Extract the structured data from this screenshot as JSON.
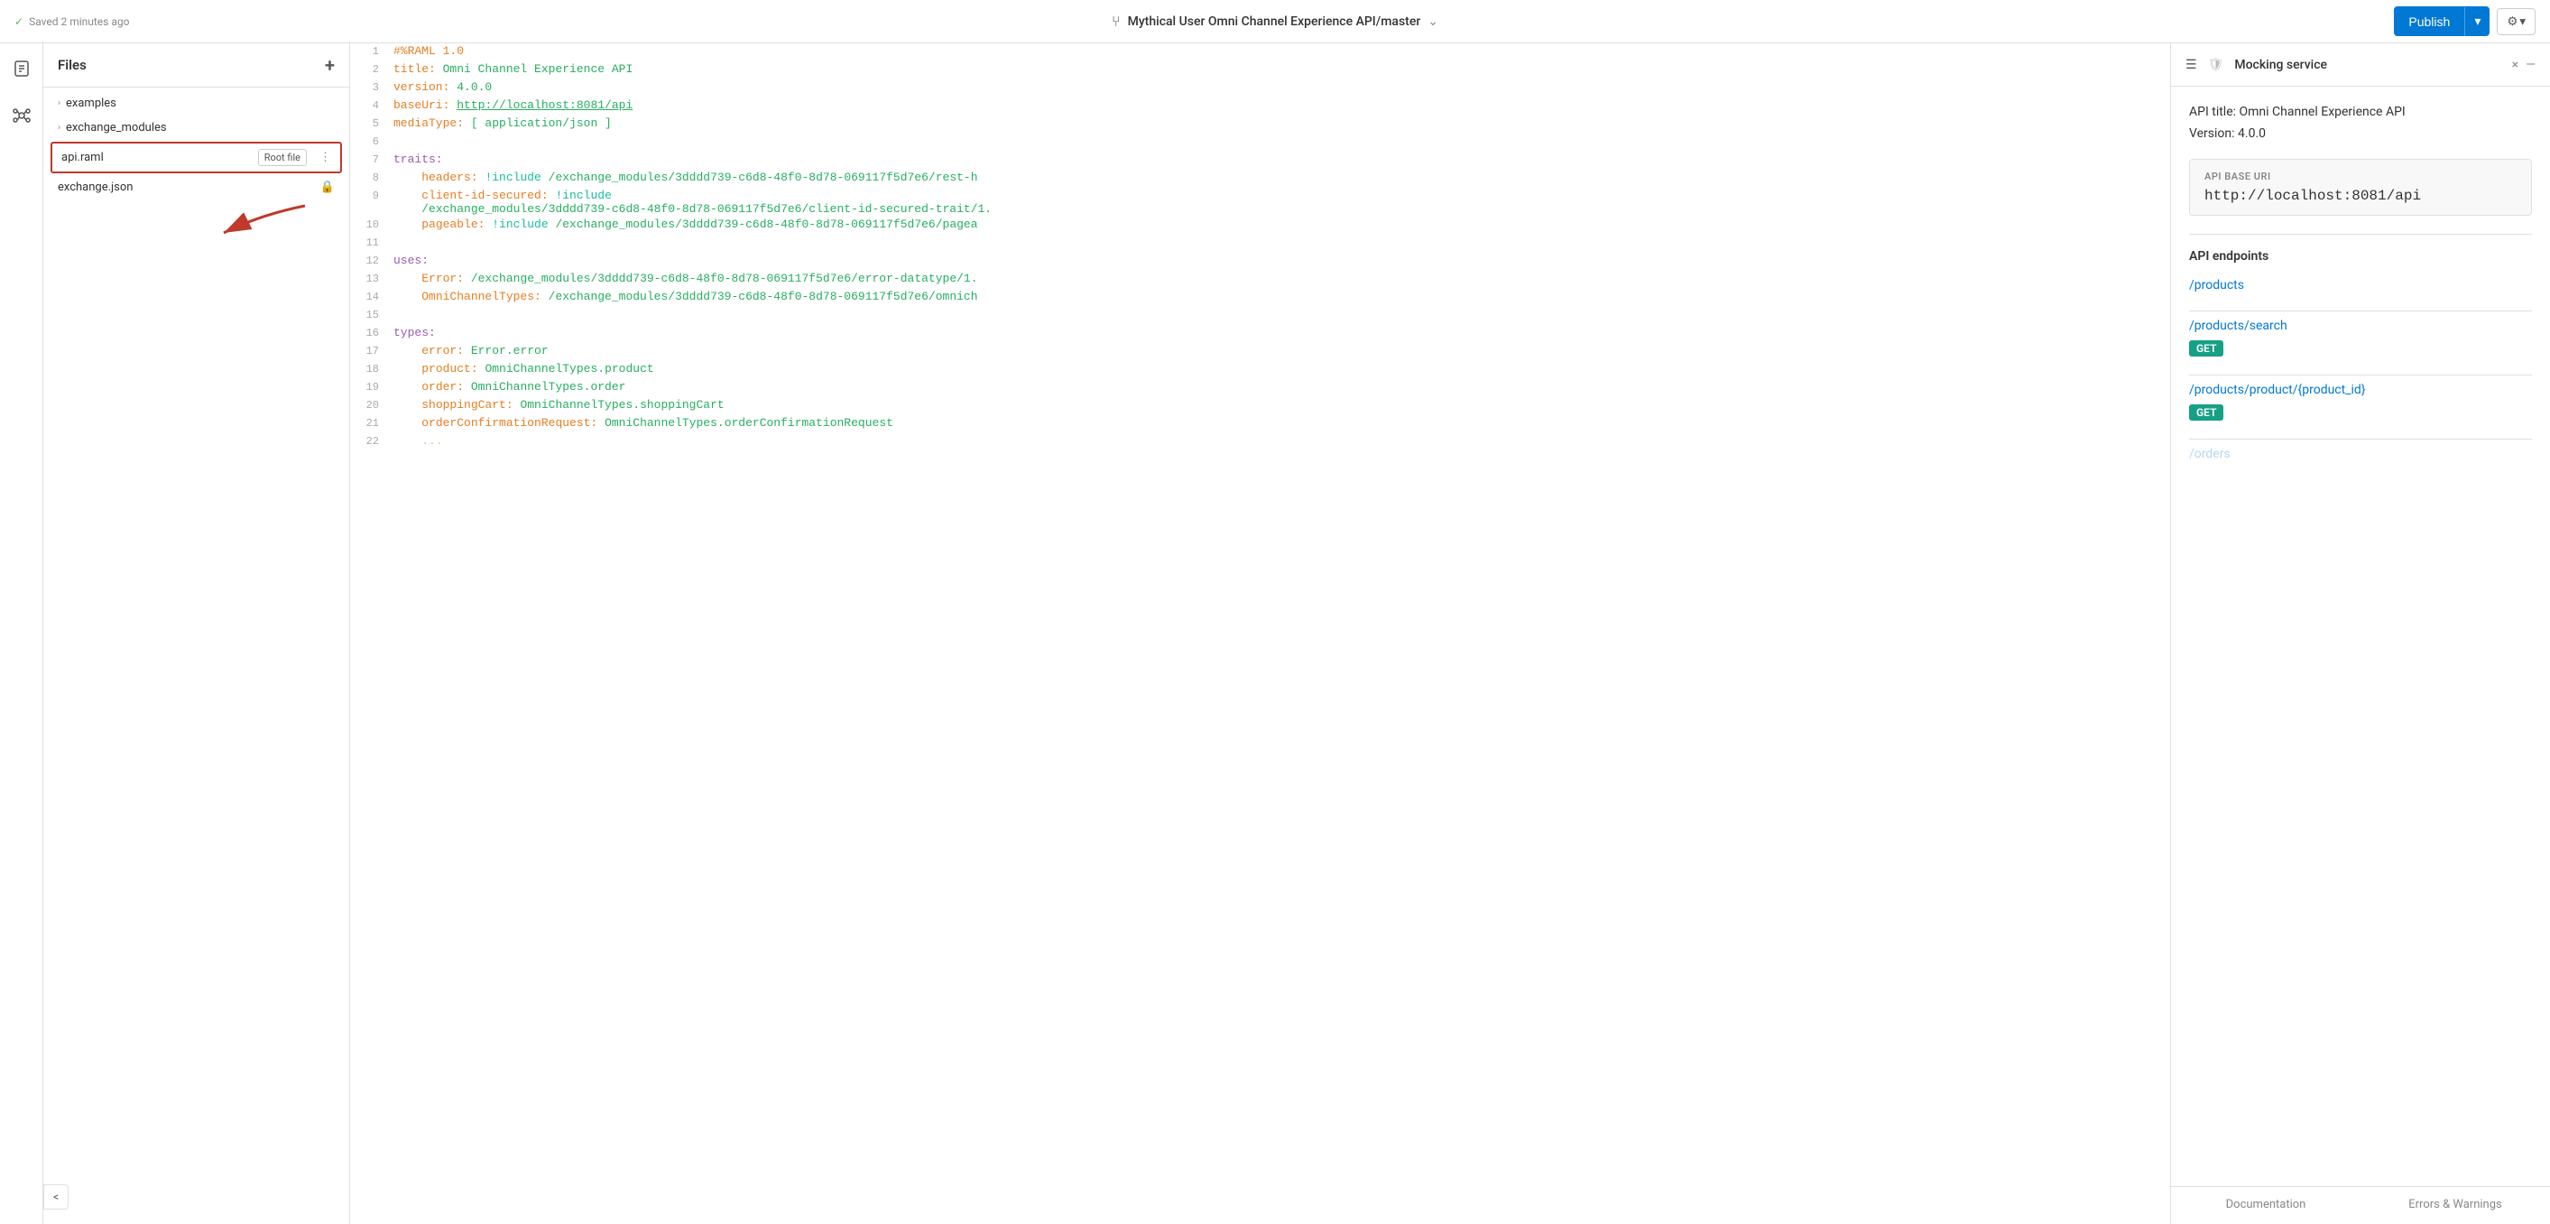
{
  "topbar": {
    "saved_status": "Saved 2 minutes ago",
    "project_name": "Mythical User Omni Channel Experience API/master",
    "publish_label": "Publish",
    "settings_label": "⚙"
  },
  "files_panel": {
    "title": "Files",
    "add_icon": "+",
    "tree": [
      {
        "id": "examples",
        "name": "examples",
        "type": "folder",
        "expanded": false
      },
      {
        "id": "exchange_modules",
        "name": "exchange_modules",
        "type": "folder",
        "expanded": false
      },
      {
        "id": "api_raml",
        "name": "api.raml",
        "type": "file",
        "selected": true,
        "root_badge": "Root file"
      },
      {
        "id": "exchange_json",
        "name": "exchange.json",
        "type": "file",
        "locked": true
      }
    ]
  },
  "editor": {
    "lines": [
      {
        "num": 1,
        "content": "#%RAML 1.0",
        "type": "comment"
      },
      {
        "num": 2,
        "content": "title: Omni Channel Experience API",
        "type": "normal"
      },
      {
        "num": 3,
        "content": "version: 4.0.0",
        "type": "normal"
      },
      {
        "num": 4,
        "content": "baseUri: http://localhost:8081/api",
        "type": "uri"
      },
      {
        "num": 5,
        "content": "mediaType: [ application/json ]",
        "type": "normal"
      },
      {
        "num": 6,
        "content": "",
        "type": "empty"
      },
      {
        "num": 7,
        "content": "traits:",
        "type": "key"
      },
      {
        "num": 8,
        "content": "  headers: !include /exchange_modules/3dddd739-c6d8-48f0-8d78-069117f5d7e6/rest-h",
        "type": "include"
      },
      {
        "num": 9,
        "content": "  client-id-secured: !include\n/exchange_modules/3dddd739-c6d8-48f0-8d78-069117f5d7e6/client-id-secured-trait/1.",
        "type": "include"
      },
      {
        "num": 10,
        "content": "  pageable: !include /exchange_modules/3dddd739-c6d8-48f0-8d78-069117f5d7e6/pagea",
        "type": "include"
      },
      {
        "num": 11,
        "content": "",
        "type": "empty"
      },
      {
        "num": 12,
        "content": "uses:",
        "type": "key"
      },
      {
        "num": 13,
        "content": "  Error: /exchange_modules/3dddd739-c6d8-48f0-8d78-069117f5d7e6/error-datatype/1.",
        "type": "uses_val"
      },
      {
        "num": 14,
        "content": "  OmniChannelTypes: /exchange_modules/3dddd739-c6d8-48f0-8d78-069117f5d7e6/omnich",
        "type": "uses_val"
      },
      {
        "num": 15,
        "content": "",
        "type": "empty"
      },
      {
        "num": 16,
        "content": "types:",
        "type": "key"
      },
      {
        "num": 17,
        "content": "  error: Error.error",
        "type": "type_val"
      },
      {
        "num": 18,
        "content": "  product: OmniChannelTypes.product",
        "type": "type_val"
      },
      {
        "num": 19,
        "content": "  order: OmniChannelTypes.order",
        "type": "type_val"
      },
      {
        "num": 20,
        "content": "  shoppingCart: OmniChannelTypes.shoppingCart",
        "type": "type_val"
      },
      {
        "num": 21,
        "content": "  orderConfirmationRequest: OmniChannelTypes.orderConfirmationRequest",
        "type": "type_val"
      },
      {
        "num": 22,
        "content": "  ...",
        "type": "truncated"
      }
    ]
  },
  "right_panel": {
    "title": "Mocking service",
    "close_label": "×",
    "dash_label": "—",
    "api_title_label": "API title:",
    "api_title_value": "Omni Channel Experience API",
    "version_label": "Version:",
    "version_value": "4.0.0",
    "base_uri_section_label": "API base URI",
    "base_uri_value": "http://localhost:8081/api",
    "endpoints_section_label": "API endpoints",
    "endpoints": [
      {
        "path": "/products",
        "methods": []
      },
      {
        "path": "/products/search",
        "methods": [
          "GET"
        ]
      },
      {
        "path": "/products/product/{product_id}",
        "methods": [
          "GET"
        ]
      },
      {
        "path": "/orders",
        "methods": [],
        "partial": true
      }
    ],
    "tabs": [
      {
        "id": "documentation",
        "label": "Documentation",
        "active": false
      },
      {
        "id": "errors-warnings",
        "label": "Errors & Warnings",
        "active": false
      }
    ]
  },
  "icons": {
    "hamburger": "☰",
    "shield": "🛡",
    "close": "×",
    "dash": "—",
    "chevron_right": "›",
    "chevron_down": "∨",
    "lock": "🔒",
    "more": "⋮",
    "fork": "⑂",
    "check": "✓",
    "collapse": "<",
    "gear": "⚙",
    "arrow_dropdown": "▾"
  }
}
